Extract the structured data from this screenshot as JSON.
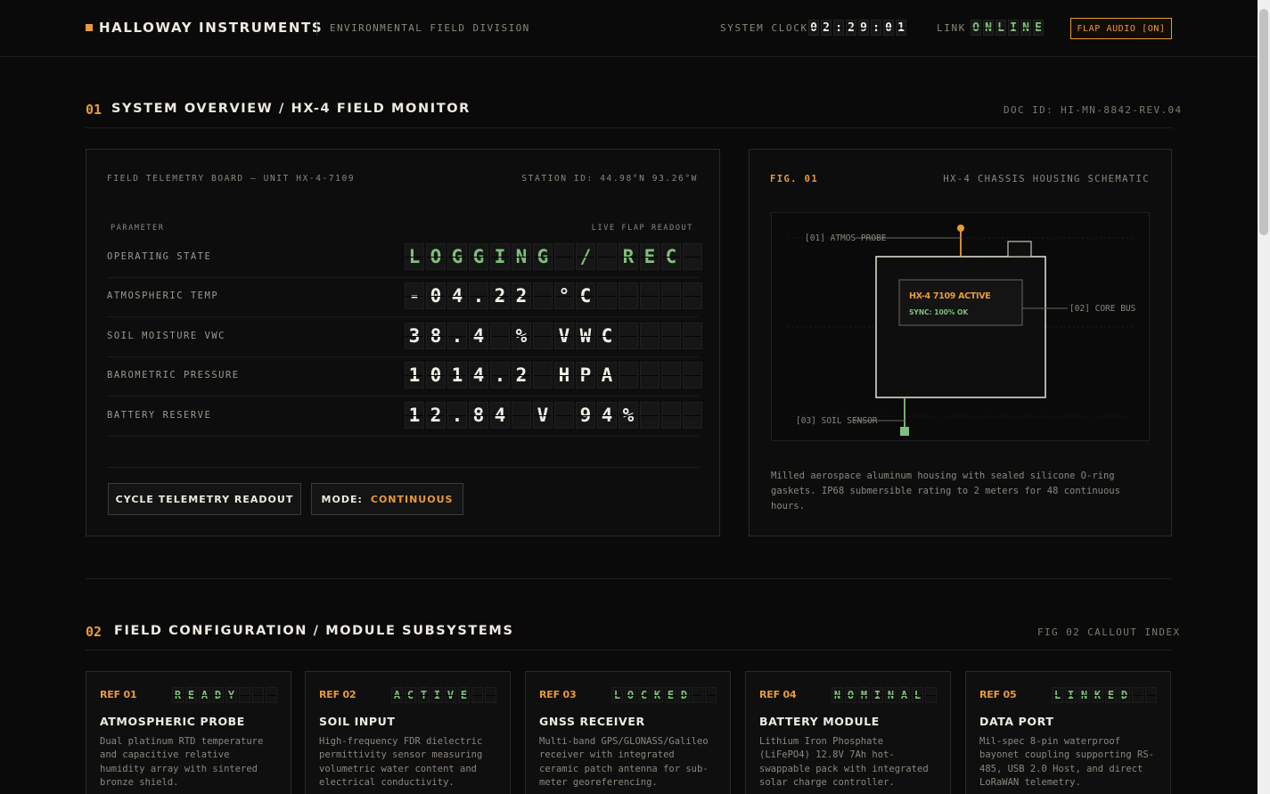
{
  "header": {
    "brand": "HALLOWAY INSTRUMENTS",
    "division": "ENVIRONMENTAL FIELD DIVISION",
    "clock_label": "SYSTEM CLOCK",
    "clock_chars": [
      "0",
      "2",
      ":",
      "2",
      "9",
      ":",
      "0",
      "1"
    ],
    "link_label": "LINK",
    "link_chars": [
      "O",
      "N",
      "L",
      "I",
      "N",
      "E"
    ],
    "audio_button": "FLAP AUDIO [ON]"
  },
  "section1": {
    "number": "01",
    "title": "SYSTEM OVERVIEW / HX-4 FIELD MONITOR",
    "doc_id": "DOC ID: HI-MN-8842-REV.04"
  },
  "telemetry": {
    "board_title": "FIELD TELEMETRY BOARD — UNIT HX-4-7109",
    "station_id": "STATION ID: 44.98°N 93.26°W",
    "col_parameter": "PARAMETER",
    "col_readout": "LIVE FLAP READOUT",
    "rows": [
      {
        "label": "OPERATING STATE",
        "value": "LOGGING / REC",
        "color": "green"
      },
      {
        "label": "ATMOSPHERIC TEMP",
        "value": "-04.22 °C",
        "color": "white"
      },
      {
        "label": "SOIL MOISTURE VWC",
        "value": "38.4 % VWC",
        "color": "white"
      },
      {
        "label": "BAROMETRIC PRESSURE",
        "value": "1014.2 HPA",
        "color": "white"
      },
      {
        "label": "BATTERY RESERVE",
        "value": "12.84 V 94%",
        "color": "white"
      }
    ],
    "cycle_button": "CYCLE TELEMETRY READOUT",
    "mode_label": "MODE:",
    "mode_value": "CONTINUOUS"
  },
  "schematic": {
    "fig_label": "FIG. 01",
    "fig_title": "HX-4 CHASSIS HOUSING SCHEMATIC",
    "callout_1": "[01] ATMOS PROBE",
    "callout_2": "[02] CORE BUS",
    "callout_3": "[03] SOIL SENSOR",
    "unit_status": "HX-4 7109 ACTIVE",
    "sync_status": "SYNC: 100% OK",
    "description": "Milled aerospace aluminum housing with sealed silicone O-ring gaskets. IP68 submersible rating to 2 meters for 48 continuous hours."
  },
  "section2": {
    "number": "02",
    "title": "FIELD CONFIGURATION / MODULE SUBSYSTEMS",
    "meta": "FIG 02 CALLOUT INDEX"
  },
  "modules": [
    {
      "ref": "REF 01",
      "status": "READY",
      "title": "ATMOSPHERIC PROBE",
      "desc": "Dual platinum RTD temperature and capacitive relative humidity array with sintered bronze shield."
    },
    {
      "ref": "REF 02",
      "status": "ACTIVE",
      "title": "SOIL INPUT",
      "desc": "High-frequency FDR dielectric permittivity sensor measuring volumetric water content and electrical conductivity."
    },
    {
      "ref": "REF 03",
      "status": "LOCKED",
      "title": "GNSS RECEIVER",
      "desc": "Multi-band GPS/GLONASS/Galileo receiver with integrated ceramic patch antenna for sub-meter georeferencing."
    },
    {
      "ref": "REF 04",
      "status": "NOMINAL",
      "title": "BATTERY MODULE",
      "desc": "Lithium Iron Phosphate (LiFePO4) 12.8V 7Ah hot-swappable pack with integrated solar charge controller."
    },
    {
      "ref": "REF 05",
      "status": "LINKED",
      "title": "DATA PORT",
      "desc": "Mil-spec 8-pin waterproof bayonet coupling supporting RS-485, USB 2.0 Host, and direct LoRaWAN telemetry."
    }
  ],
  "colors": {
    "accent": "#e89a3a",
    "status_green": "#7fc07a",
    "background": "#0a0a0a"
  }
}
